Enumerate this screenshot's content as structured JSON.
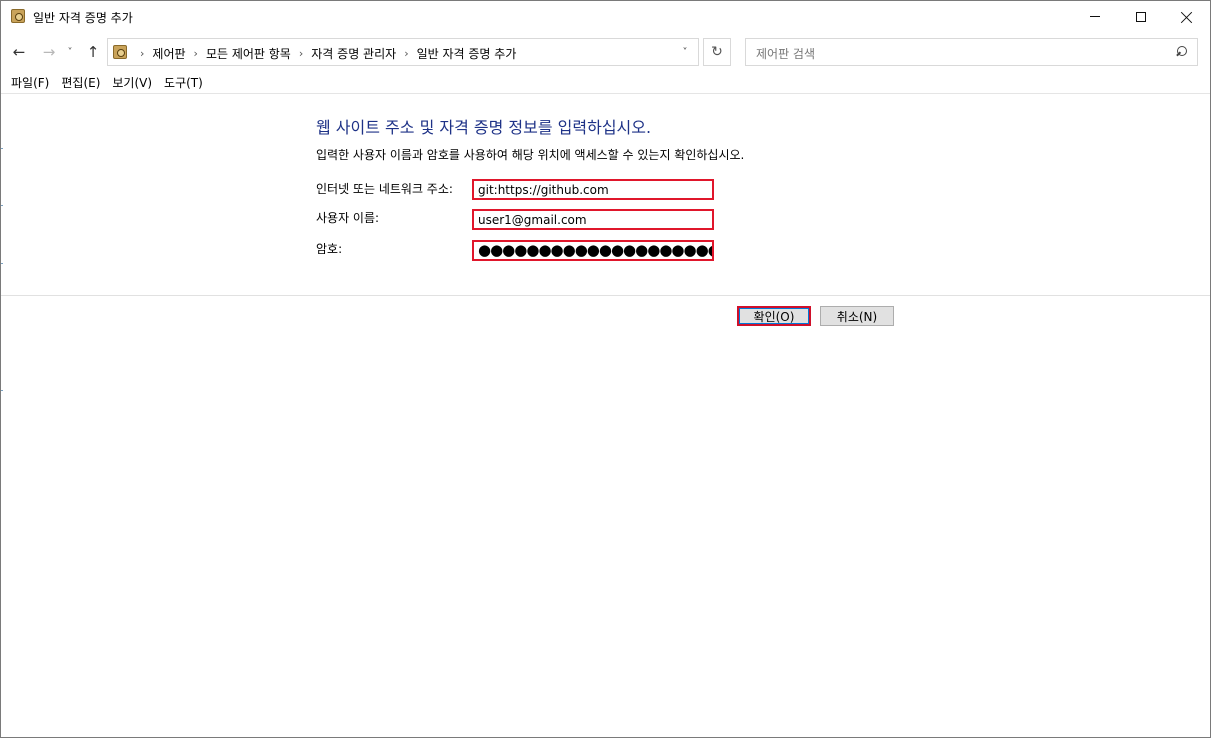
{
  "window": {
    "title": "일반 자격 증명 추가"
  },
  "nav": {
    "back_icon": "←",
    "forward_icon": "→",
    "recent_icon": "˅",
    "up_icon": "↑",
    "refresh_icon": "↻",
    "dropdown_icon": "˅",
    "breadcrumbs": [
      "제어판",
      "모든 제어판 항목",
      "자격 증명 관리자",
      "일반 자격 증명 추가"
    ],
    "separator": "›",
    "search_placeholder": "제어판 검색"
  },
  "menu": {
    "items": [
      "파일(F)",
      "편집(E)",
      "보기(V)",
      "도구(T)"
    ]
  },
  "form": {
    "heading": "웹 사이트 주소 및 자격 증명 정보를 입력하십시오.",
    "subtext": "입력한 사용자 이름과 암호를 사용하여 해당 위치에 액세스할 수 있는지 확인하십시오.",
    "address_label": "인터넷 또는 네트워크 주소:",
    "address_value": "git:https://github.com",
    "username_label": "사용자 이름:",
    "username_value": "user1@gmail.com",
    "password_label": "암호:",
    "password_mask": "●●●●●●●●●●●●●●●●●●●●●"
  },
  "buttons": {
    "ok_label": "확인(O)",
    "cancel_label": "취소(N)"
  },
  "colors": {
    "heading": "#1e3287",
    "highlight_border": "#e0162b",
    "focus_accent": "#0078d7"
  }
}
